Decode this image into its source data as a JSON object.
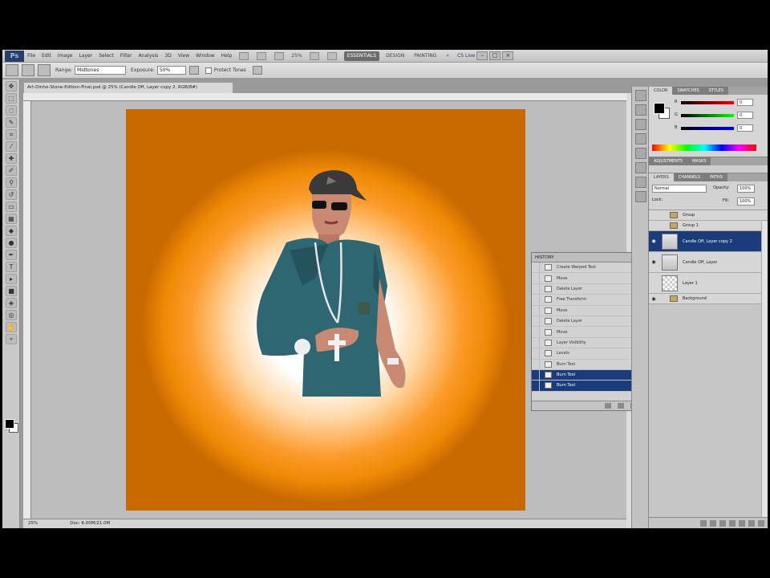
{
  "menubar": {
    "logo": "Ps",
    "items": [
      "File",
      "Edit",
      "Image",
      "Layer",
      "Select",
      "Filter",
      "Analysis",
      "3D",
      "View",
      "Window",
      "Help"
    ],
    "zoom": "25%",
    "workspaces": [
      "ESSENTIALS",
      "DESIGN",
      "PAINTING",
      "»"
    ],
    "cs_live": "CS Live",
    "window_controls": [
      "–",
      "□",
      "×"
    ]
  },
  "options": {
    "range_label": "Range:",
    "range_value": "Midtones",
    "exposure_label": "Exposure:",
    "exposure_value": "50%",
    "protect_tones_label": "Protect Tones"
  },
  "document": {
    "tab_title": "Art-Dinho-Stone-Edition-Final.psd @ 25% (Candle Off, Layer copy 2, RGB/8#)",
    "status_zoom": "25%",
    "status_doc": "Doc: 6.00M/21.0M"
  },
  "history": {
    "title": "HISTORY",
    "items": [
      {
        "label": "Create Warped Text",
        "selected": false
      },
      {
        "label": "Move",
        "selected": false
      },
      {
        "label": "Delete Layer",
        "selected": false
      },
      {
        "label": "Free Transform",
        "selected": false
      },
      {
        "label": "Move",
        "selected": false
      },
      {
        "label": "Delete Layer",
        "selected": false
      },
      {
        "label": "Move",
        "selected": false
      },
      {
        "label": "Layer Visibility",
        "selected": false
      },
      {
        "label": "Levels",
        "selected": false
      },
      {
        "label": "Burn Tool",
        "selected": false
      },
      {
        "label": "Burn Tool",
        "selected": true
      },
      {
        "label": "Burn Tool",
        "selected": true
      }
    ]
  },
  "color_panel": {
    "tabs": [
      "COLOR",
      "SWATCHES",
      "STYLES"
    ],
    "r_label": "R",
    "g_label": "G",
    "b_label": "B",
    "r_value": "0",
    "g_value": "0",
    "b_value": "0"
  },
  "adjust_panel": {
    "tabs": [
      "ADJUSTMENTS",
      "MASKS"
    ]
  },
  "layers_panel": {
    "tabs": [
      "LAYERS",
      "CHANNELS",
      "PATHS"
    ],
    "blend_mode": "Normal",
    "opacity_label": "Opacity:",
    "opacity_value": "100%",
    "fill_label": "Fill:",
    "fill_value": "100%",
    "lock_label": "Lock:",
    "layers": [
      {
        "name": "Group",
        "kind": "group",
        "selected": false,
        "visible": false
      },
      {
        "name": "Group 1",
        "kind": "group",
        "selected": false,
        "visible": false
      },
      {
        "name": "Candle Off, Layer copy 2",
        "kind": "photo",
        "selected": true,
        "visible": true
      },
      {
        "name": "Candle Off, Layer",
        "kind": "photo",
        "selected": false,
        "visible": true
      },
      {
        "name": "Layer 1",
        "kind": "chk",
        "selected": false,
        "visible": false
      },
      {
        "name": "Background",
        "kind": "group",
        "selected": false,
        "visible": true
      }
    ]
  },
  "colors": {
    "accent_selected": "#1a3c7a",
    "artwork_orange": "#ef8a06",
    "shirt_teal": "#2e6672"
  }
}
